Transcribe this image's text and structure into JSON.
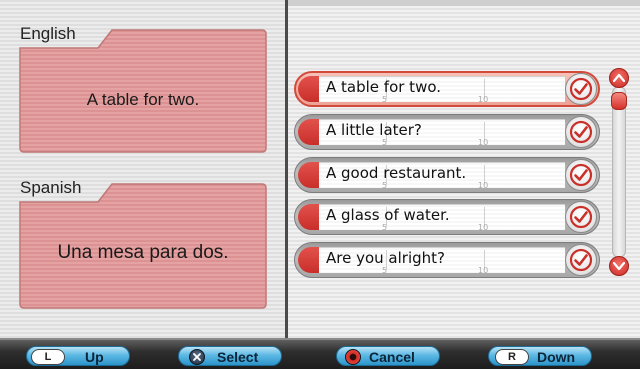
{
  "left_panel": {
    "source_language": "English",
    "source_text": "A table for two.",
    "target_language": "Spanish",
    "target_text": "Una mesa para dos."
  },
  "phrase_list": {
    "selected_index": 0,
    "items": [
      {
        "text": "A table for two.",
        "tick_5": "5",
        "tick_10": "10"
      },
      {
        "text": "A little later?",
        "tick_5": "5",
        "tick_10": "10"
      },
      {
        "text": "A good restaurant.",
        "tick_5": "5",
        "tick_10": "10"
      },
      {
        "text": "A glass of water.",
        "tick_5": "5",
        "tick_10": "10"
      },
      {
        "text": "Are you alright?",
        "tick_5": "5",
        "tick_10": "10"
      }
    ],
    "item_icon": "checkmark-icon",
    "scroll_position": 0.0
  },
  "bottom_bar": {
    "up": {
      "glyph": "L",
      "label": "Up"
    },
    "select": {
      "glyph_icon": "x-button-icon",
      "label": "Select"
    },
    "cancel": {
      "glyph_icon": "circle-button-icon",
      "label": "Cancel"
    },
    "down": {
      "glyph": "R",
      "label": "Down"
    }
  },
  "colors": {
    "card_pink": "#e39a9a",
    "accent_red": "#d02b22",
    "button_blue": "#5db9e4",
    "selected_row": "#f4b0a5"
  }
}
